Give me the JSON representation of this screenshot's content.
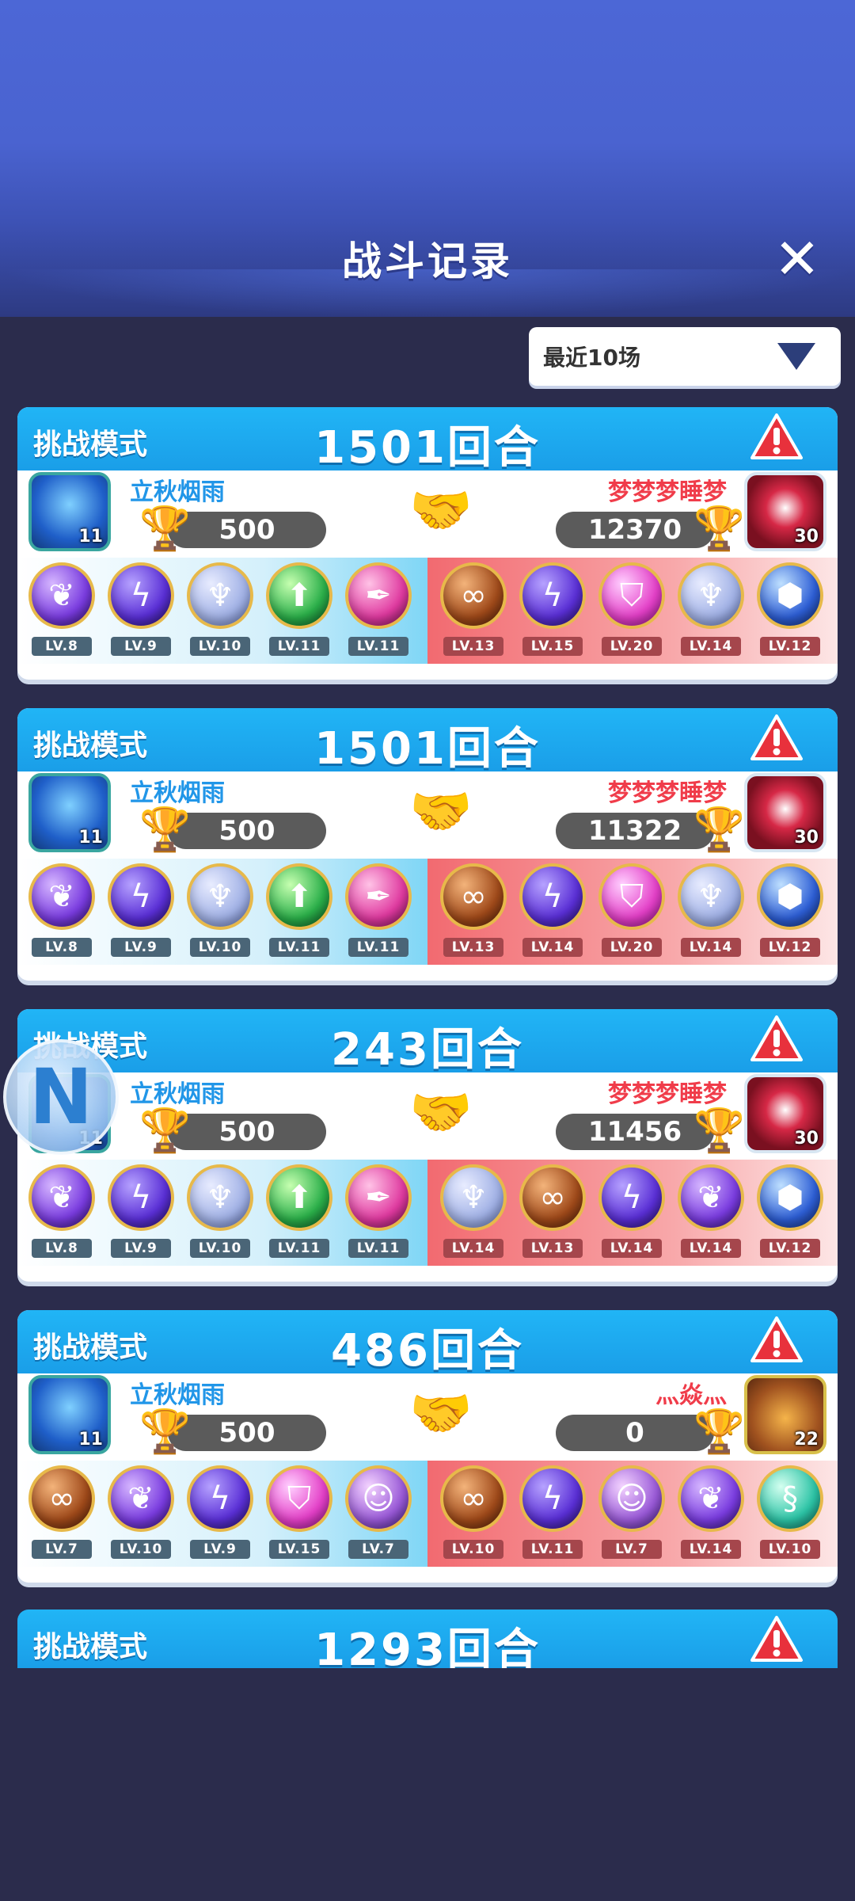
{
  "header": {
    "title": "战斗记录",
    "close_icon": "close-icon"
  },
  "filter": {
    "selected": "最近10场",
    "icon": "chevron-down-icon"
  },
  "colors": {
    "accent_blue": "#1fb0f3",
    "left_name": "#2196e8",
    "right_name": "#f03c4a"
  },
  "battles": [
    {
      "mode": "挑战模式",
      "rounds": "1501回合",
      "left": {
        "name": "立秋烟雨",
        "trophies": "500",
        "avatar_level": "11"
      },
      "right": {
        "name": "梦梦梦睡梦",
        "trophies": "12370",
        "avatar_level": "30"
      },
      "left_pets": [
        "LV.8",
        "LV.9",
        "LV.10",
        "LV.11",
        "LV.11"
      ],
      "right_pets": [
        "LV.13",
        "LV.15",
        "LV.20",
        "LV.14",
        "LV.12"
      ]
    },
    {
      "mode": "挑战模式",
      "rounds": "1501回合",
      "left": {
        "name": "立秋烟雨",
        "trophies": "500",
        "avatar_level": "11"
      },
      "right": {
        "name": "梦梦梦睡梦",
        "trophies": "11322",
        "avatar_level": "30"
      },
      "left_pets": [
        "LV.8",
        "LV.9",
        "LV.10",
        "LV.11",
        "LV.11"
      ],
      "right_pets": [
        "LV.13",
        "LV.14",
        "LV.20",
        "LV.14",
        "LV.12"
      ]
    },
    {
      "mode": "挑战模式",
      "rounds": "243回合",
      "left": {
        "name": "立秋烟雨",
        "trophies": "500",
        "avatar_level": "11"
      },
      "right": {
        "name": "梦梦梦睡梦",
        "trophies": "11456",
        "avatar_level": "30"
      },
      "left_pets": [
        "LV.8",
        "LV.9",
        "LV.10",
        "LV.11",
        "LV.11"
      ],
      "right_pets": [
        "LV.14",
        "LV.13",
        "LV.14",
        "LV.14",
        "LV.12"
      ]
    },
    {
      "mode": "挑战模式",
      "rounds": "486回合",
      "left": {
        "name": "立秋烟雨",
        "trophies": "500",
        "avatar_level": "11"
      },
      "right": {
        "name": "灬焱灬",
        "trophies": "0",
        "avatar_level": "22"
      },
      "left_pets": [
        "LV.7",
        "LV.10",
        "LV.9",
        "LV.15",
        "LV.7"
      ],
      "right_pets": [
        "LV.10",
        "LV.11",
        "LV.7",
        "LV.14",
        "LV.10"
      ]
    },
    {
      "mode": "挑战模式",
      "rounds": "1293回合"
    }
  ]
}
